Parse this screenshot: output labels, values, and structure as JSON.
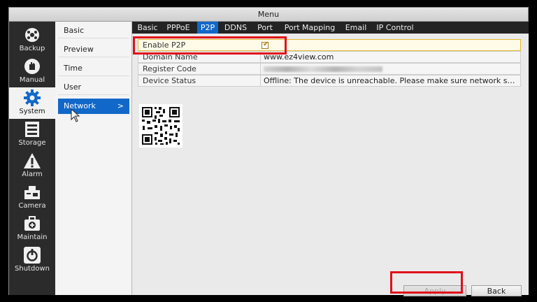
{
  "window": {
    "title": "Menu"
  },
  "leftnav": [
    {
      "label": "Backup",
      "icon": "backup-icon"
    },
    {
      "label": "Manual",
      "icon": "hand-icon"
    },
    {
      "label": "System",
      "icon": "gear-icon",
      "active": true
    },
    {
      "label": "Storage",
      "icon": "storage-icon"
    },
    {
      "label": "Alarm",
      "icon": "alarm-icon"
    },
    {
      "label": "Camera",
      "icon": "camera-icon"
    },
    {
      "label": "Maintain",
      "icon": "maintain-icon"
    },
    {
      "label": "Shutdown",
      "icon": "power-icon"
    }
  ],
  "submenu": {
    "items": [
      "Basic",
      "Preview",
      "Time",
      "User",
      "Network"
    ],
    "active": "Network",
    "arrow": ">"
  },
  "tabs": [
    "Basic",
    "PPPoE",
    "P2P",
    "DDNS",
    "Port",
    "Port Mapping",
    "Email",
    "IP Control"
  ],
  "active_tab": "P2P",
  "form": {
    "enable_p2p": {
      "label": "Enable P2P",
      "checked": true,
      "check_glyph": "✔"
    },
    "domain_name": {
      "label": "Domain Name",
      "value": "www.ez4view.com"
    },
    "register_code": {
      "label": "Register Code",
      "value": ""
    },
    "device_status": {
      "label": "Device Status",
      "value": "Offline: The device is unreachable. Please make sure network settings (s..."
    }
  },
  "buttons": {
    "apply": "Apply",
    "back": "Back"
  },
  "colors": {
    "accent": "#1268c9",
    "highlight": "#e0101a",
    "nav_bg": "#2b2b2b"
  }
}
